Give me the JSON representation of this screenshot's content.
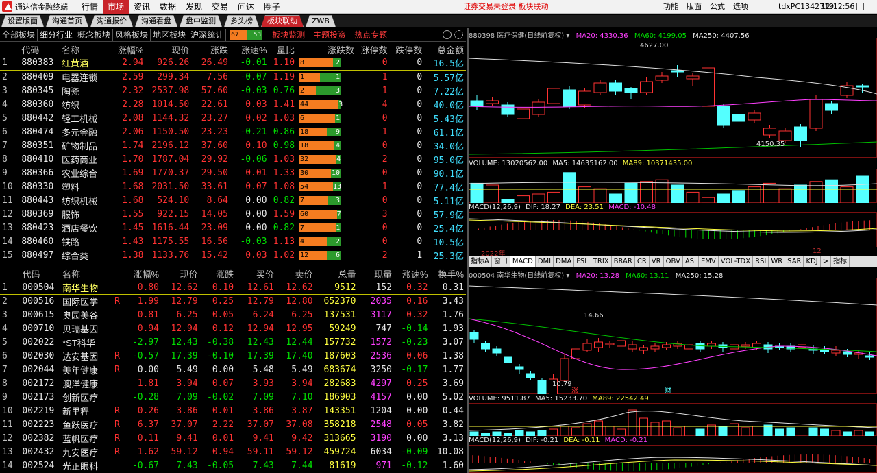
{
  "app": {
    "logo_text": "通达信金融终端",
    "menu": [
      "行情",
      "市场",
      "资讯",
      "数据",
      "发现",
      "交易",
      "问达",
      "圈子"
    ],
    "active_menu": "市场",
    "notice": "证券交易未登录  板块联动",
    "right_menu": [
      "功能",
      "版面",
      "公式",
      "选项"
    ],
    "user": "tdxPC1342719",
    "clock": "12:12:56"
  },
  "tabs": [
    "设置版面",
    "沟通首页",
    "沟通报价",
    "沟通看盘",
    "盘中监测",
    "多头榜",
    "板块联动",
    "ZWB"
  ],
  "active_tab": "板块联动",
  "subtabs": [
    "全部板块",
    "细分行业",
    "概念板块",
    "风格板块",
    "地区板块",
    "沪深统计"
  ],
  "active_subtab": "细分行业",
  "mini_updown": {
    "up": "67",
    "down": "53"
  },
  "subtabs_red": [
    "板块监测",
    "主题投资",
    "热点专题"
  ],
  "sector_table": {
    "headers": [
      "",
      "代码",
      "名称",
      "涨幅%",
      "现价",
      "涨跌",
      "涨速%",
      "量比",
      "涨跌数",
      "涨停数",
      "跌停数",
      "总金额"
    ],
    "rows": [
      [
        "1",
        "880383",
        "红黄酒",
        "2.94",
        "926.26",
        "26.49",
        "-0.01",
        "1.10",
        "8",
        "2",
        "0",
        "0",
        "16.5亿"
      ],
      [
        "2",
        "880409",
        "电器连锁",
        "2.59",
        "299.34",
        "7.56",
        "-0.07",
        "1.19",
        "1",
        "1",
        "1",
        "0",
        "5.57亿"
      ],
      [
        "3",
        "880345",
        "陶瓷",
        "2.32",
        "2537.98",
        "57.60",
        "-0.03",
        "0.76",
        "2",
        "3",
        "1",
        "0",
        "7.22亿"
      ],
      [
        "4",
        "880360",
        "纺织",
        "2.28",
        "1014.50",
        "22.61",
        "0.03",
        "1.41",
        "44",
        "3",
        "4",
        "0",
        "40.0亿"
      ],
      [
        "5",
        "880442",
        "轻工机械",
        "2.08",
        "1144.32",
        "23.27",
        "0.02",
        "1.03",
        "6",
        "1",
        "0",
        "0",
        "5.43亿"
      ],
      [
        "6",
        "880474",
        "多元金融",
        "2.06",
        "1150.50",
        "23.23",
        "-0.21",
        "0.86",
        "18",
        "9",
        "1",
        "0",
        "61.1亿"
      ],
      [
        "7",
        "880351",
        "矿物制品",
        "1.74",
        "2196.12",
        "37.60",
        "0.10",
        "0.98",
        "18",
        "4",
        "0",
        "0",
        "34.0亿"
      ],
      [
        "8",
        "880410",
        "医药商业",
        "1.70",
        "1787.04",
        "29.92",
        "-0.06",
        "1.03",
        "32",
        "4",
        "2",
        "0",
        "95.0亿"
      ],
      [
        "9",
        "880366",
        "农业综合",
        "1.69",
        "1770.37",
        "29.50",
        "0.01",
        "1.33",
        "30",
        "10",
        "0",
        "0",
        "90.1亿"
      ],
      [
        "10",
        "880330",
        "塑料",
        "1.68",
        "2031.50",
        "33.61",
        "0.07",
        "1.08",
        "54",
        "13",
        "1",
        "0",
        "77.4亿"
      ],
      [
        "11",
        "880443",
        "纺织机械",
        "1.68",
        "524.10",
        "8.64",
        "0.00",
        "0.82",
        "7",
        "3",
        "0",
        "0",
        "5.11亿"
      ],
      [
        "12",
        "880369",
        "服饰",
        "1.55",
        "922.15",
        "14.05",
        "0.00",
        "1.59",
        "60",
        "7",
        "3",
        "0",
        "57.9亿"
      ],
      [
        "13",
        "880423",
        "酒店餐饮",
        "1.45",
        "1616.44",
        "23.09",
        "0.00",
        "0.82",
        "7",
        "1",
        "0",
        "0",
        "25.4亿"
      ],
      [
        "14",
        "880460",
        "铁路",
        "1.43",
        "1175.55",
        "16.56",
        "-0.03",
        "1.13",
        "4",
        "2",
        "0",
        "0",
        "10.5亿"
      ],
      [
        "15",
        "880497",
        "综合类",
        "1.38",
        "1133.76",
        "15.42",
        "0.03",
        "1.02",
        "12",
        "6",
        "2",
        "1",
        "25.3亿"
      ]
    ]
  },
  "stock_table": {
    "headers": [
      "",
      "代码",
      "名称",
      "",
      "涨幅%",
      "现价",
      "涨跌",
      "买价",
      "卖价",
      "总量",
      "现量",
      "涨速%",
      "换手%"
    ],
    "rows": [
      [
        "1",
        "000504",
        "南华生物",
        "",
        "0.80",
        "12.62",
        "0.10",
        "12.61",
        "12.62",
        "9512",
        "152",
        "0.32",
        "0.31"
      ],
      [
        "2",
        "000516",
        "国际医学",
        "R",
        "1.99",
        "12.79",
        "0.25",
        "12.79",
        "12.80",
        "652370",
        "2035",
        "0.16",
        "3.43"
      ],
      [
        "3",
        "000615",
        "奥园美谷",
        "",
        "0.81",
        "6.25",
        "0.05",
        "6.24",
        "6.25",
        "137531",
        "3117",
        "0.32",
        "1.76"
      ],
      [
        "4",
        "000710",
        "贝瑞基因",
        "",
        "0.94",
        "12.94",
        "0.12",
        "12.94",
        "12.95",
        "59249",
        "747",
        "-0.14",
        "1.93"
      ],
      [
        "5",
        "002022",
        "*ST科华",
        "",
        "-2.97",
        "12.43",
        "-0.38",
        "12.43",
        "12.44",
        "157732",
        "1572",
        "-0.23",
        "3.07"
      ],
      [
        "6",
        "002030",
        "达安基因",
        "R",
        "-0.57",
        "17.39",
        "-0.10",
        "17.39",
        "17.40",
        "187603",
        "2536",
        "0.06",
        "1.38"
      ],
      [
        "7",
        "002044",
        "美年健康",
        "R",
        "0.00",
        "5.49",
        "0.00",
        "5.48",
        "5.49",
        "683674",
        "3250",
        "-0.17",
        "1.77"
      ],
      [
        "8",
        "002172",
        "澳洋健康",
        "",
        "1.81",
        "3.94",
        "0.07",
        "3.93",
        "3.94",
        "282683",
        "4297",
        "0.25",
        "3.69"
      ],
      [
        "9",
        "002173",
        "创新医疗",
        "",
        "-0.28",
        "7.09",
        "-0.02",
        "7.09",
        "7.10",
        "186903",
        "4157",
        "0.00",
        "5.02"
      ],
      [
        "10",
        "002219",
        "新里程",
        "R",
        "0.26",
        "3.86",
        "0.01",
        "3.86",
        "3.87",
        "143351",
        "1204",
        "0.00",
        "0.44"
      ],
      [
        "11",
        "002223",
        "鱼跃医疗",
        "R",
        "6.37",
        "37.07",
        "2.22",
        "37.07",
        "37.08",
        "358218",
        "2548",
        "0.05",
        "3.82"
      ],
      [
        "12",
        "002382",
        "蓝帆医疗",
        "R",
        "0.11",
        "9.41",
        "0.01",
        "9.41",
        "9.42",
        "313665",
        "3190",
        "0.00",
        "3.13"
      ],
      [
        "13",
        "002432",
        "九安医疗",
        "R",
        "1.62",
        "59.12",
        "0.94",
        "59.11",
        "59.12",
        "459724",
        "6034",
        "-0.09",
        "10.08"
      ],
      [
        "14",
        "002524",
        "光正眼科",
        "",
        "-0.67",
        "7.43",
        "-0.05",
        "7.43",
        "7.44",
        "81619",
        "971",
        "-0.12",
        "1.60"
      ]
    ]
  },
  "chart_top": {
    "title": "880398 医疗保健(日线前复权)",
    "ma20_label": "MA20: 4330.36",
    "ma60_label": "MA60: 4199.05",
    "ma250_label": "MA250: 4407.56",
    "high_label": "4627.00",
    "low_label": "4150.35",
    "volume_label": "VOLUME: 13020562.00",
    "vol_ma5_label": "MA5: 14635162.00",
    "vol_ma89_label": "MA89: 10371435.00",
    "macd_label": "MACD(12,26,9)",
    "dif_label": "DIF: 18.27",
    "dea_label": "DEA: 23.51",
    "macd_val_label": "MACD: -10.48",
    "year_label": "2022年",
    "month_label": "12"
  },
  "indicator_tabs": [
    "指标A",
    "窗口",
    "MACD",
    "DMI",
    "DMA",
    "FSL",
    "TRIX",
    "BRAR",
    "CR",
    "VR",
    "OBV",
    "ASI",
    "EMV",
    "VOL-TDX",
    "RSI",
    "WR",
    "SAR",
    "KDJ",
    ">",
    "指标"
  ],
  "chart_bottom": {
    "title": "000504 南华生物(日线前复权)",
    "ma20_label": "MA20: 13.28",
    "ma60_label": "MA60: 13.11",
    "ma250_label": "MA250: 15.28",
    "high_label": "14.66",
    "low_label": "10.79",
    "marker_zhang": "涨",
    "marker_cai": "财",
    "volume_label": "VOLUME: 9511.87",
    "vol_ma5_label": "MA5: 15233.70",
    "vol_ma89_label": "MA89: 22542.49",
    "macd_label": "MACD(12,26,9)",
    "dif_label": "DIF: -0.21",
    "dea_label": "DEA: -0.11",
    "macd_val_label": "MACD: -0.21"
  },
  "colors": {
    "up": "#ff3232",
    "down": "#00e000",
    "accent": "#c9242a",
    "cyan": "#40e0ff"
  }
}
